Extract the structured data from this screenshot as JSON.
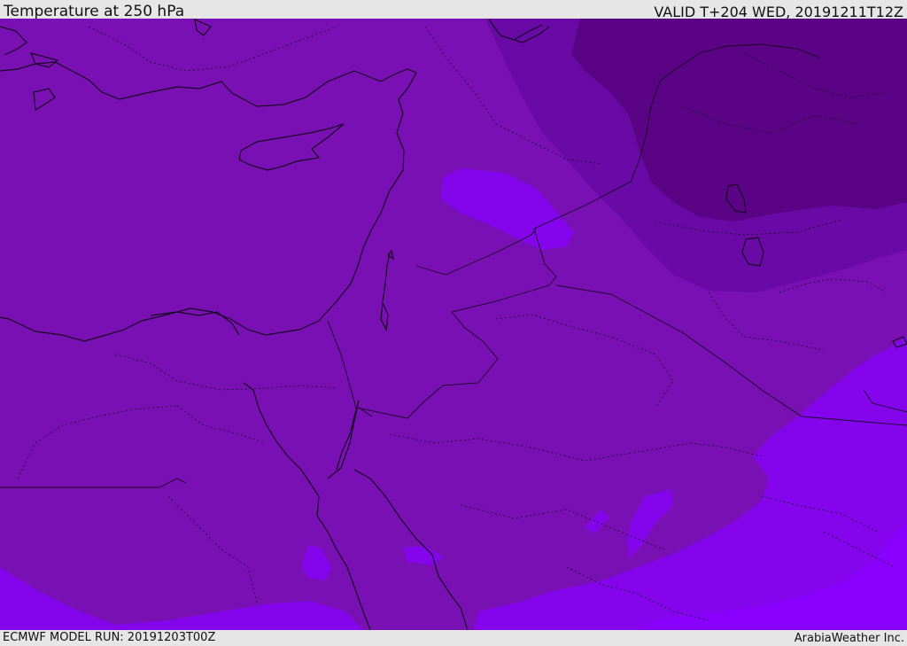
{
  "header": {
    "title": "Temperature at 250 hPa",
    "valid": "VALID T+204 WED, 20191211T12Z"
  },
  "footer": {
    "model_run": "ECMWF MODEL RUN: 20191203T00Z",
    "credit": "ArabiaWeather Inc."
  },
  "map": {
    "region": "Eastern Mediterranean and Middle East",
    "field_colors": {
      "base": "#7910b4",
      "cold": "#690aa6",
      "coldest": "#5a0384",
      "warm": "#8405eb",
      "warmest": "#8900ff"
    },
    "line_color": "#1a0822"
  }
}
